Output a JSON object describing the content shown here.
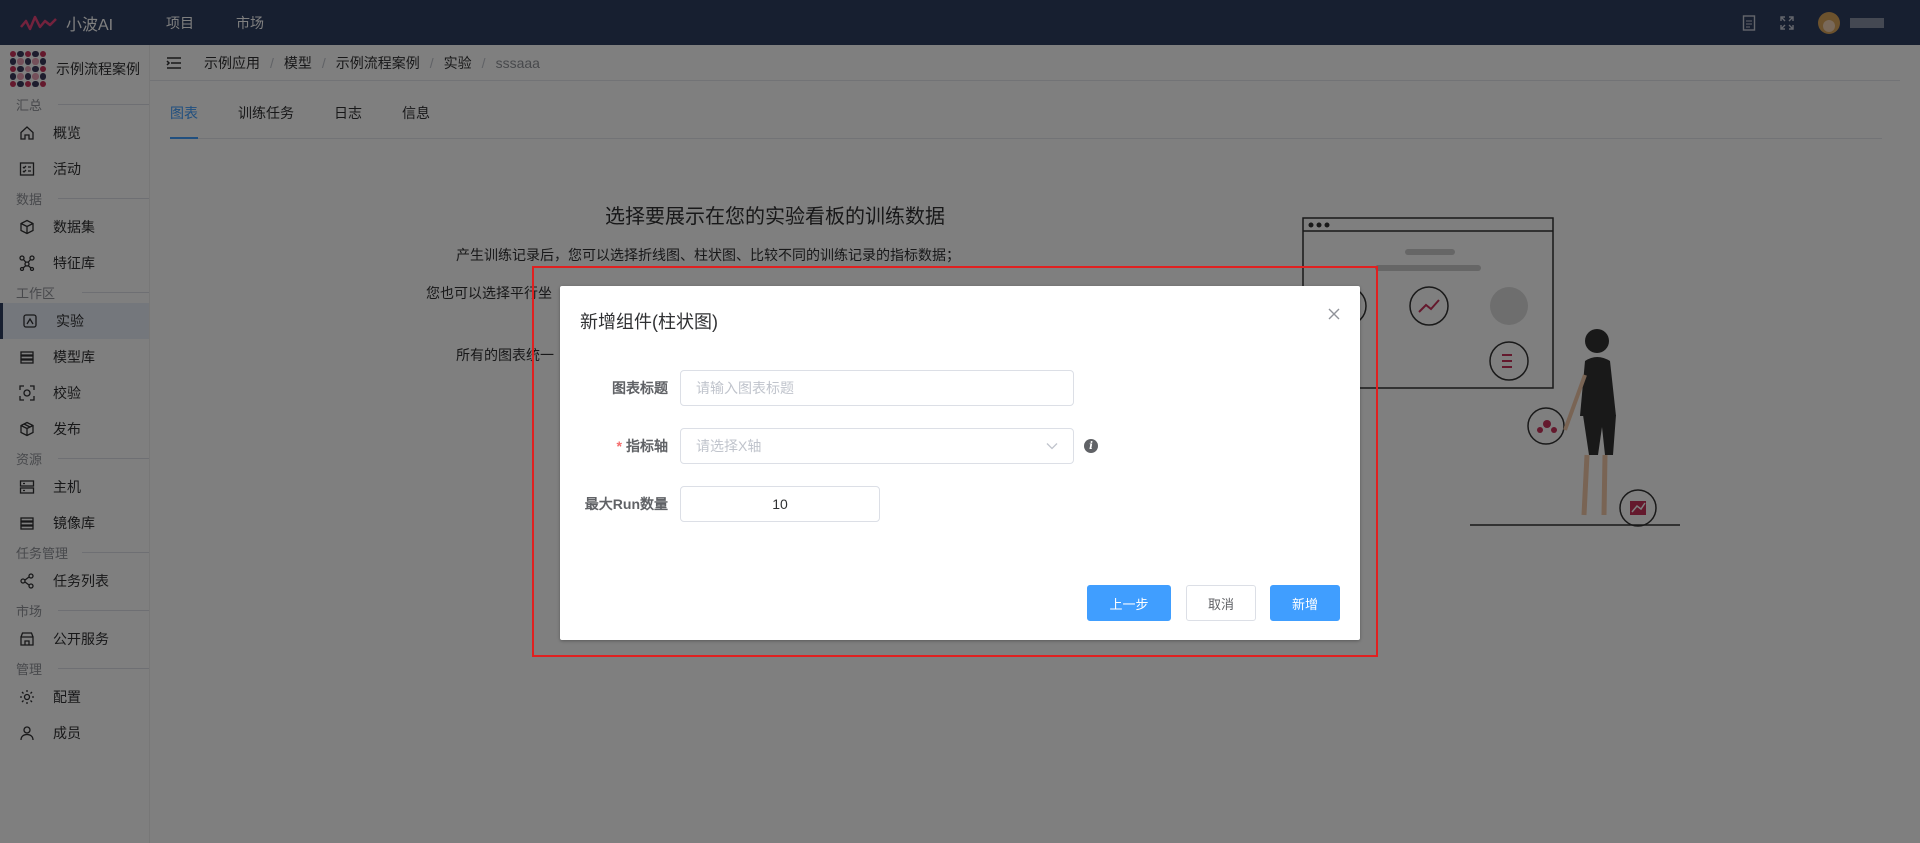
{
  "app": {
    "name": "小波AI"
  },
  "topnav": [
    "项目",
    "市场"
  ],
  "sidebar": {
    "project_name": "示例流程案例",
    "sections": [
      {
        "title": "汇总",
        "items": [
          {
            "label": "概览",
            "icon": "home-icon"
          },
          {
            "label": "活动",
            "icon": "activity-icon"
          }
        ]
      },
      {
        "title": "数据",
        "items": [
          {
            "label": "数据集",
            "icon": "cube-icon"
          },
          {
            "label": "特征库",
            "icon": "network-icon"
          }
        ]
      },
      {
        "title": "工作区",
        "items": [
          {
            "label": "实验",
            "icon": "experiment-icon",
            "active": true
          },
          {
            "label": "模型库",
            "icon": "stack-icon"
          },
          {
            "label": "校验",
            "icon": "scan-icon"
          },
          {
            "label": "发布",
            "icon": "box-icon"
          }
        ]
      },
      {
        "title": "资源",
        "items": [
          {
            "label": "主机",
            "icon": "server-icon"
          },
          {
            "label": "镜像库",
            "icon": "layers-icon"
          }
        ]
      },
      {
        "title": "任务管理",
        "items": [
          {
            "label": "任务列表",
            "icon": "share-icon"
          }
        ]
      },
      {
        "title": "市场",
        "items": [
          {
            "label": "公开服务",
            "icon": "store-icon"
          }
        ]
      },
      {
        "title": "管理",
        "items": [
          {
            "label": "配置",
            "icon": "gear-icon"
          },
          {
            "label": "成员",
            "icon": "user-icon"
          }
        ]
      }
    ]
  },
  "breadcrumb": [
    "示例应用",
    "模型",
    "示例流程案例",
    "实验",
    "sssaaa"
  ],
  "tabs": [
    "图表",
    "训练任务",
    "日志",
    "信息"
  ],
  "empty": {
    "title": "选择要展示在您的实验看板的训练数据",
    "line1": "产生训练记录后，您可以选择折线图、柱状图、比较不同的训练记录的指标数据；",
    "line2": "您也可以选择平行坐",
    "line3": "所有的图表统一"
  },
  "dialog": {
    "title": "新增组件(柱状图)",
    "fields": {
      "chart_title_label": "图表标题",
      "chart_title_placeholder": "请输入图表标题",
      "axis_label": "指标轴",
      "axis_placeholder": "请选择X轴",
      "max_run_label": "最大Run数量",
      "max_run_value": "10"
    },
    "buttons": {
      "prev": "上一步",
      "cancel": "取消",
      "add": "新增"
    }
  },
  "colors": {
    "topbar": "#2f3e60",
    "primary": "#409eff",
    "required": "#f56c6c",
    "highlight_box": "#e02020"
  }
}
